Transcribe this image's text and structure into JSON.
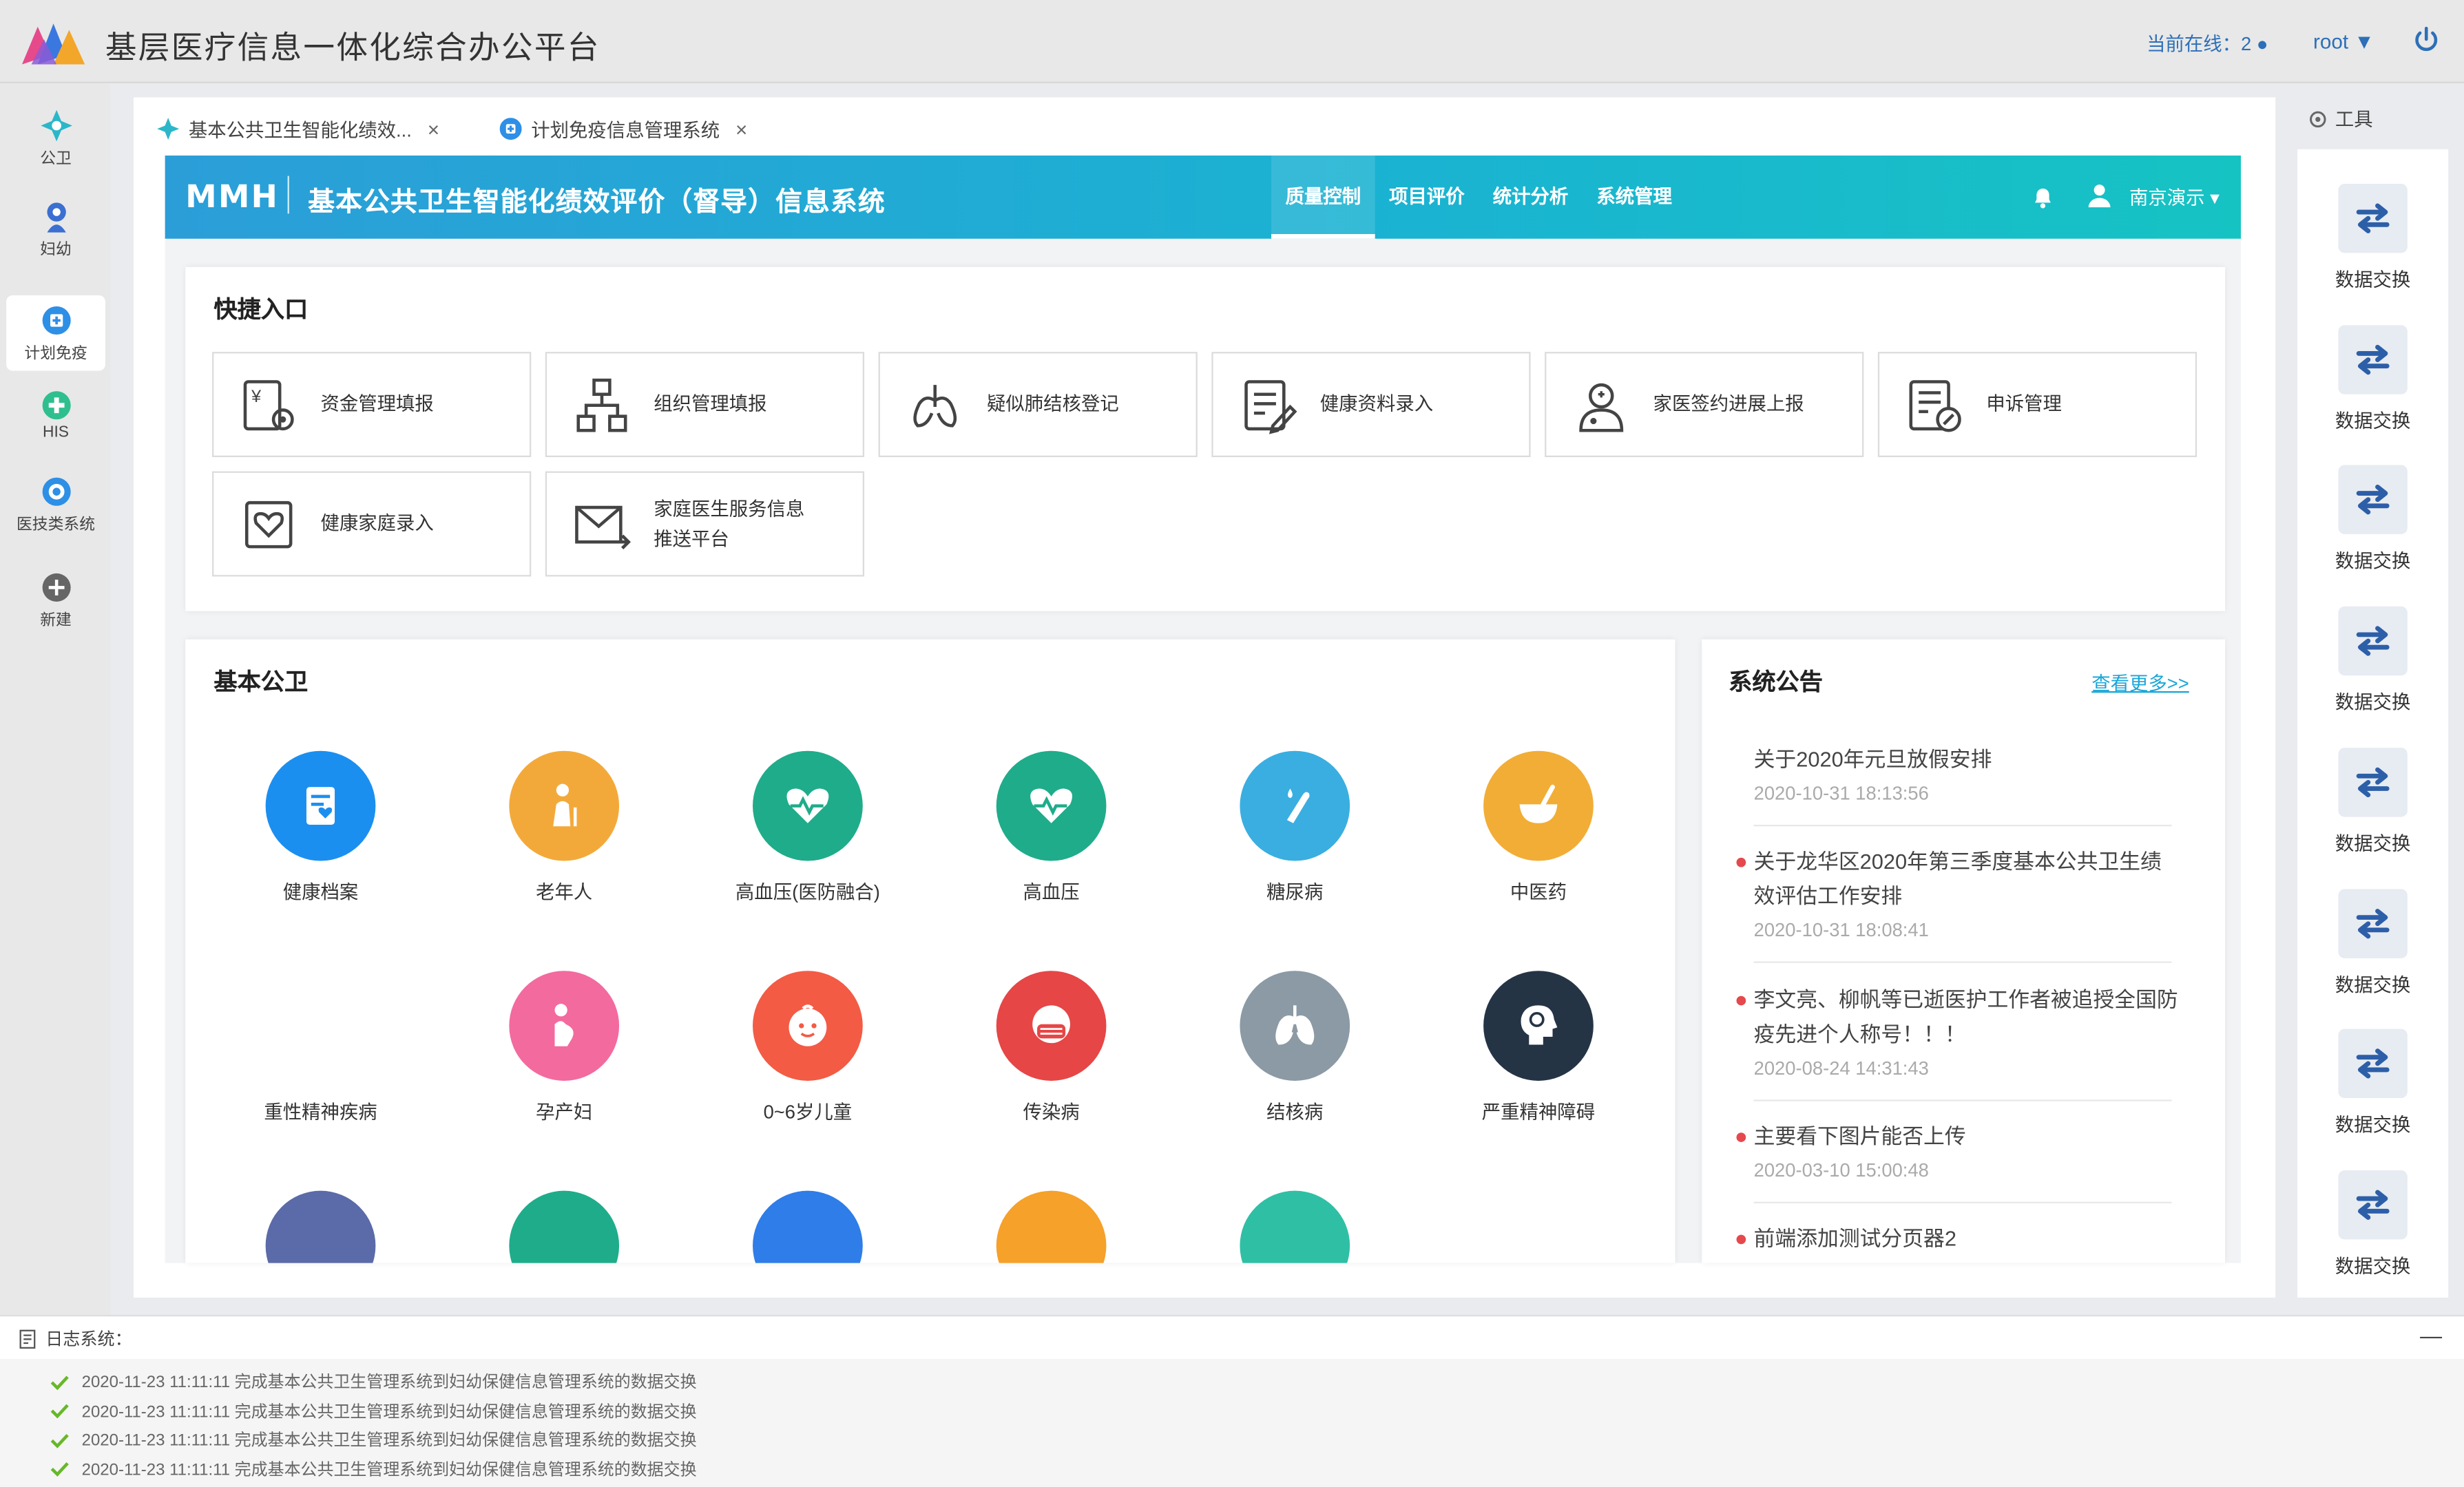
{
  "app": {
    "title": "基层医疗信息一体化综合办公平台",
    "online_label": "当前在线：2",
    "user": "root"
  },
  "sidebar": [
    {
      "label": "公卫",
      "icon": "gongwei-icon",
      "color": "#2bb7c9"
    },
    {
      "label": "妇幼",
      "icon": "maternal-icon",
      "color": "#3b6fd1"
    },
    {
      "label": "计划免疫",
      "icon": "vaccine-icon",
      "color": "#2e8fe6",
      "active": true
    },
    {
      "label": "HIS",
      "icon": "his-icon",
      "color": "#2fbf8e"
    },
    {
      "label": "医技类系统",
      "icon": "medtech-icon",
      "color": "#2e8fe6"
    },
    {
      "label": "新建",
      "icon": "add-icon",
      "color": "#666666"
    }
  ],
  "tabs": [
    {
      "label": "基本公共卫生智能化绩效...",
      "close": "×"
    },
    {
      "label": "计划免疫信息管理系统",
      "close": "×"
    }
  ],
  "banner": {
    "logo_text": "MMH",
    "title": "基本公共卫生智能化绩效评价（督导）信息系统",
    "nav": [
      "质量控制",
      "项目评价",
      "统计分析",
      "系统管理"
    ],
    "region": "南京演示"
  },
  "quick": {
    "title": "快捷入口",
    "items": [
      "资金管理填报",
      "组织管理填报",
      "疑似肺结核登记",
      "健康资料录入",
      "家医签约进展上报",
      "申诉管理",
      "健康家庭录入",
      "家庭医生服务信息推送平台"
    ],
    "item8_line1": "家庭医生服务信息",
    "item8_line2": "推送平台"
  },
  "basic": {
    "title": "基本公卫",
    "items": [
      {
        "label": "健康档案",
        "color": "#1b8ff0"
      },
      {
        "label": "老年人",
        "color": "#f3a93a"
      },
      {
        "label": "高血压(医防融合)",
        "color": "#1fac8a"
      },
      {
        "label": "高血压",
        "color": "#1fac8a"
      },
      {
        "label": "糖尿病",
        "color": "#3aaee0"
      },
      {
        "label": "中医药",
        "color": "#f2ad36"
      },
      {
        "label": "重性精神疾病",
        "color": ""
      },
      {
        "label": "孕产妇",
        "color": "#f36a9f"
      },
      {
        "label": "0~6岁儿童",
        "color": "#f35b45"
      },
      {
        "label": "传染病",
        "color": "#e64646"
      },
      {
        "label": "结核病",
        "color": "#8b9aa5"
      },
      {
        "label": "严重精神障碍",
        "color": "#253445"
      }
    ],
    "row3_colors": [
      "#5b6aa8",
      "#1fac8a",
      "#2e7de8",
      "#f5a12a",
      "#2fbfa5"
    ]
  },
  "notices": {
    "title": "系统公告",
    "more": "查看更多>>",
    "items": [
      {
        "title": "关于2020年元旦放假安排",
        "date": "2020-10-31 18:13:56",
        "dot": false
      },
      {
        "title": "关于龙华区2020年第三季度基本公共卫生绩效评估工作安排",
        "date": "2020-10-31 18:08:41",
        "dot": true
      },
      {
        "title": "李文亮、柳帆等已逝医护工作者被追授全国防疫先进个人称号！！！",
        "date": "2020-08-24 14:31:43",
        "dot": true
      },
      {
        "title": "主要看下图片能否上传",
        "date": "2020-03-10 15:00:48",
        "dot": true
      },
      {
        "title": "前端添加测试分页器2",
        "date": "",
        "dot": true
      }
    ]
  },
  "tools": {
    "label": "工具",
    "exchange_label": "数据交换",
    "count": 8
  },
  "log": {
    "title": "日志系统：",
    "collapse": "—",
    "entries": [
      "2020-11-23 11:11:11 完成基本公共卫生管理系统到妇幼保健信息管理系统的数据交换",
      "2020-11-23 11:11:11 完成基本公共卫生管理系统到妇幼保健信息管理系统的数据交换",
      "2020-11-23 11:11:11 完成基本公共卫生管理系统到妇幼保健信息管理系统的数据交换",
      "2020-11-23 11:11:11 完成基本公共卫生管理系统到妇幼保健信息管理系统的数据交换"
    ]
  }
}
